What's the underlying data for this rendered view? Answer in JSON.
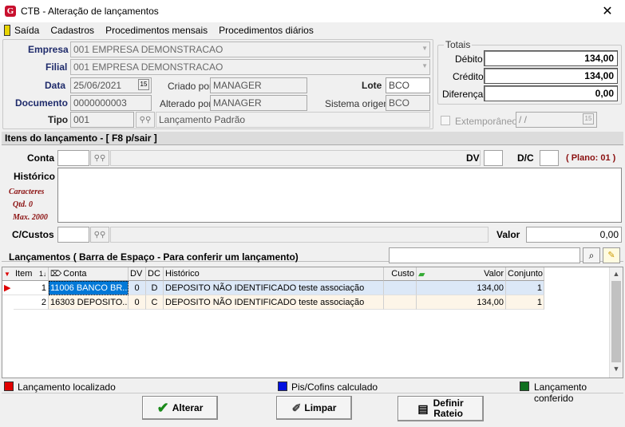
{
  "window": {
    "title": "CTB - Alteração de lançamentos",
    "logo": "G"
  },
  "menu": [
    "Saída",
    "Cadastros",
    "Procedimentos mensais",
    "Procedimentos diários"
  ],
  "header": {
    "empresa_label": "Empresa",
    "empresa_value": "001 EMPRESA DEMONSTRACAO",
    "filial_label": "Filial",
    "filial_value": "001 EMPRESA DEMONSTRACAO",
    "data_label": "Data",
    "data_value": "25/06/2021",
    "criado_label": "Criado por",
    "criado_value": "MANAGER",
    "lote_label": "Lote",
    "lote_value": "BCO",
    "documento_label": "Documento",
    "documento_value": "0000000003",
    "alterado_label": "Alterado por",
    "alterado_value": "MANAGER",
    "sistema_label": "Sistema origem",
    "sistema_value": "BCO",
    "tipo_label": "Tipo",
    "tipo_value": "001",
    "tipo_desc": "Lançamento Padrão",
    "extemp_label": "Extemporâneo",
    "extemp_value": " /  /"
  },
  "totais": {
    "title": "Totais",
    "debito_label": "Débito",
    "debito": "134,00",
    "credito_label": "Crédito",
    "credito": "134,00",
    "diferenca_label": "Diferença",
    "diferenca": "0,00"
  },
  "itens": {
    "section_title": "Itens do lançamento - [ F8 p/sair ]",
    "conta_label": "Conta",
    "dv_label": "DV",
    "dc_label": "D/C",
    "plano": "( Plano: 01 )",
    "historico_label": "Histórico",
    "caracteres": "Caracteres",
    "qtd": "Qtd. 0",
    "max": "Max. 2000",
    "ccustos_label": "C/Custos",
    "valor_label": "Valor",
    "valor_value": "0,00"
  },
  "lancamentos": {
    "title": "Lançamentos ( Barra de Espaço - Para conferir um lançamento)",
    "columns": [
      "Item",
      "Conta",
      "DV",
      "DC",
      "Histórico",
      "Custo",
      "Valor",
      "Conjunto"
    ],
    "sort_indicator": "1",
    "rows": [
      {
        "item": "1",
        "conta": "11006 BANCO BR...",
        "dv": "0",
        "dc": "D",
        "historico": "DEPOSITO NÃO IDENTIFICADO teste associação",
        "custo": "",
        "valor": "134,00",
        "conjunto": "1"
      },
      {
        "item": "2",
        "conta": "16303 DEPOSITO...",
        "dv": "0",
        "dc": "C",
        "historico": "DEPOSITO NÃO IDENTIFICADO teste associação",
        "custo": "",
        "valor": "134,00",
        "conjunto": "1"
      }
    ]
  },
  "legend": [
    {
      "label": "Lançamento localizado",
      "color": "#e00000"
    },
    {
      "label": "Pis/Cofins calculado",
      "color": "#0010e0"
    },
    {
      "label": "Lançamento conferido",
      "color": "#107020"
    }
  ],
  "buttons": {
    "alterar": "Alterar",
    "limpar": "Limpar",
    "rateio_line1": "Definir",
    "rateio_line2": "Rateio"
  }
}
